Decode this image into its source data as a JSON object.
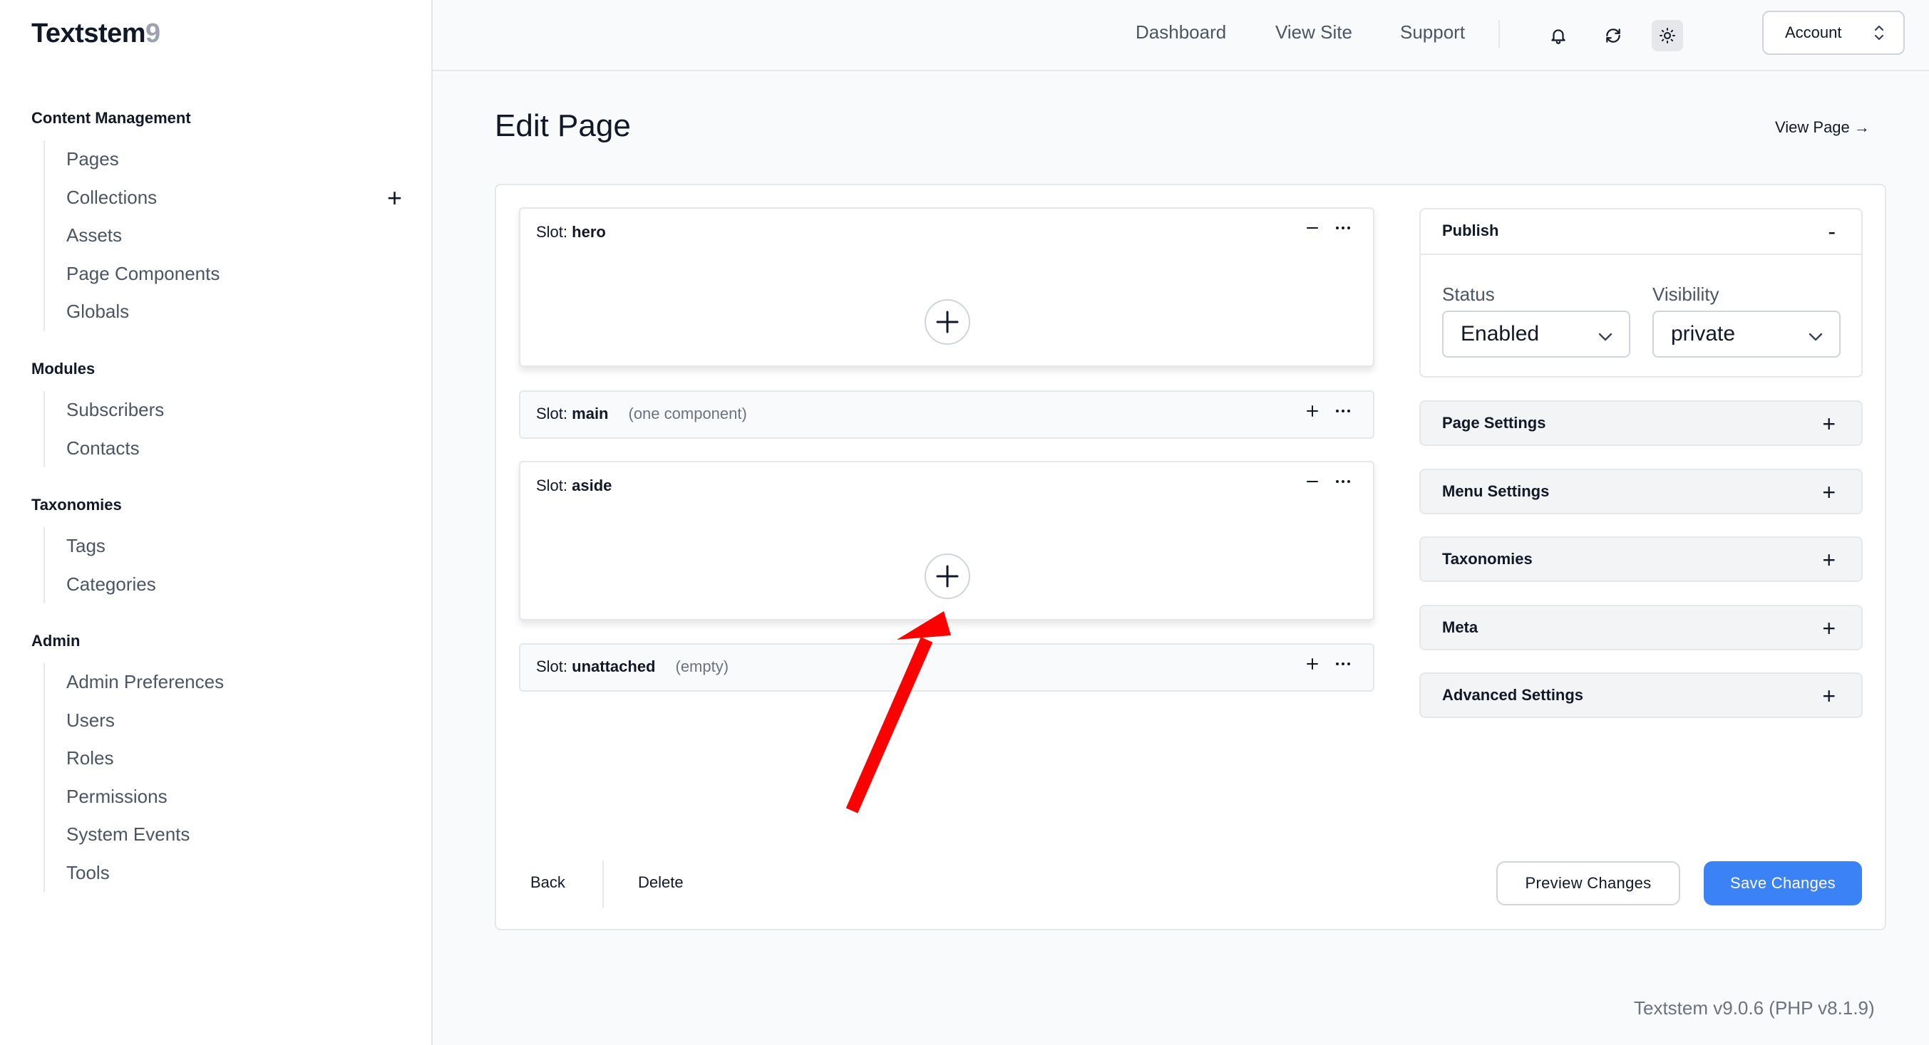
{
  "app": {
    "name": "Textstem",
    "version_mark": "9",
    "footer_version": "Textstem v9.0.6 (PHP v8.1.9)"
  },
  "sidebar": {
    "sections": [
      {
        "heading": "Content Management",
        "items": [
          {
            "label": "Pages"
          },
          {
            "label": "Collections",
            "add": "+"
          },
          {
            "label": "Assets"
          },
          {
            "label": "Page Components"
          },
          {
            "label": "Globals"
          }
        ]
      },
      {
        "heading": "Modules",
        "items": [
          {
            "label": "Subscribers"
          },
          {
            "label": "Contacts"
          }
        ]
      },
      {
        "heading": "Taxonomies",
        "items": [
          {
            "label": "Tags"
          },
          {
            "label": "Categories"
          }
        ]
      },
      {
        "heading": "Admin",
        "items": [
          {
            "label": "Admin Preferences"
          },
          {
            "label": "Users"
          },
          {
            "label": "Roles"
          },
          {
            "label": "Permissions"
          },
          {
            "label": "System Events"
          },
          {
            "label": "Tools"
          }
        ]
      }
    ]
  },
  "topbar": {
    "links": [
      {
        "label": "Dashboard"
      },
      {
        "label": "View Site"
      },
      {
        "label": "Support"
      }
    ],
    "icons": [
      "bell-icon",
      "refresh-icon",
      "sun-icon"
    ],
    "account_label": "Account"
  },
  "header": {
    "title": "Edit Page",
    "view_page": "View Page →"
  },
  "slots": [
    {
      "prefix": "Slot: ",
      "name": "hero",
      "note": "",
      "state": "expanded"
    },
    {
      "prefix": "Slot: ",
      "name": "main",
      "note": "(one component)",
      "state": "collapsed"
    },
    {
      "prefix": "Slot: ",
      "name": "aside",
      "note": "",
      "state": "expanded"
    },
    {
      "prefix": "Slot: ",
      "name": "unattached",
      "note": "(empty)",
      "state": "collapsed"
    }
  ],
  "publish": {
    "title": "Publish",
    "toggle": "-",
    "status_label": "Status",
    "status_value": "Enabled",
    "visibility_label": "Visibility",
    "visibility_value": "private"
  },
  "panels": [
    {
      "title": "Page Settings",
      "toggle": "+"
    },
    {
      "title": "Menu Settings",
      "toggle": "+"
    },
    {
      "title": "Taxonomies",
      "toggle": "+"
    },
    {
      "title": "Meta",
      "toggle": "+"
    },
    {
      "title": "Advanced Settings",
      "toggle": "+"
    }
  ],
  "footer": {
    "back": "Back",
    "delete": "Delete",
    "preview": "Preview Changes",
    "save": "Save Changes"
  },
  "colors": {
    "primary": "#3b82f6",
    "annotation_arrow": "#ff0000"
  }
}
